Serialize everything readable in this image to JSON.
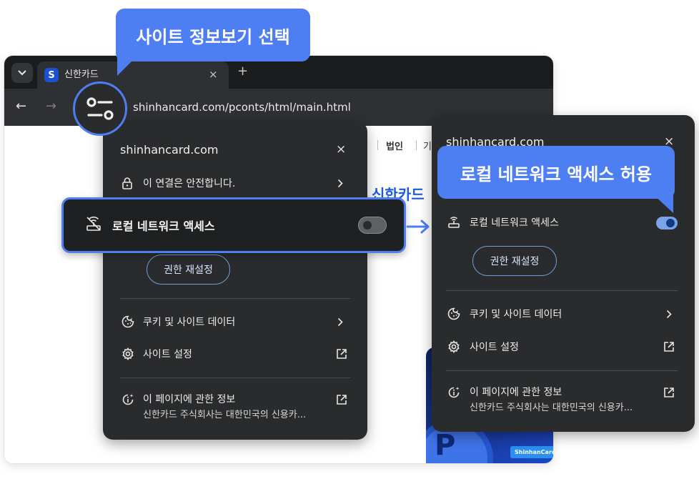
{
  "browser": {
    "tab": {
      "title": "신한카드",
      "favicon_letter": "S"
    },
    "url": "shinhancard.com/pconts/html/main.html",
    "nav_buttons": {
      "back": "←",
      "forward": "→",
      "new_tab": "+",
      "close_tab": "×",
      "tab_dropdown": "⌄"
    }
  },
  "page": {
    "nav_items": [
      "법인",
      "기"
    ],
    "brand_heading": "신한카드",
    "promo_tag": "ShinhanCard",
    "promo_letter": "P"
  },
  "left_panel": {
    "domain": "shinhancard.com",
    "close": "×",
    "connection": "이 연결은 안전합니다.",
    "local_network": "로컬 네트워크 액세스",
    "reset_button": "권한 재설정",
    "cookies": "쿠키 및 사이트 데이터",
    "site_settings": "사이트 설정",
    "about_title": "이 페이지에 관한 정보",
    "about_desc": "신한카드 주식회사는 대한민국의 신용카..."
  },
  "right_panel": {
    "domain": "shinhancard.com",
    "close": "×",
    "local_network": "로컬 네트워크 액세스",
    "reset_button": "권한 재설정",
    "cookies": "쿠키 및 사이트 데이터",
    "site_settings": "사이트 설정",
    "about_title": "이 페이지에 관한 정보",
    "about_desc": "신한카드 주식회사는 대한민국의 신용카..."
  },
  "toggles": {
    "left_local_network_on": false,
    "right_local_network_on": true
  },
  "callouts": {
    "site_info": "사이트 정보보기 선택",
    "allow_local_network": "로컬 네트워크 액세스 허용"
  },
  "colors": {
    "accent": "#4d7ef2",
    "panel_bg": "#2a2b2d",
    "brand_blue": "#1a5be3"
  },
  "icons": [
    "site-info-tune-icon",
    "lock-icon",
    "network-off-icon",
    "network-icon",
    "cookie-icon",
    "gear-icon",
    "info-sparkle-icon",
    "external-link-icon",
    "chevron-right-icon",
    "close-icon"
  ]
}
